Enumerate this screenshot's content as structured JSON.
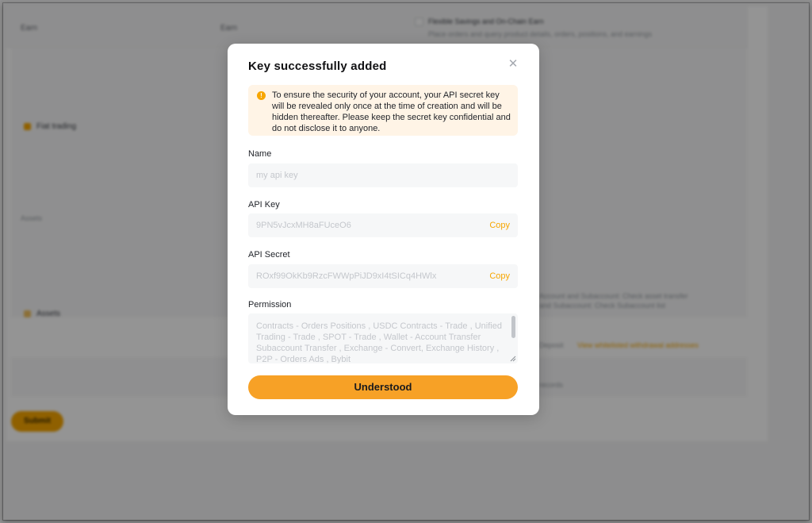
{
  "modal": {
    "title": "Key successfully added",
    "close_icon": "close-icon",
    "notice": {
      "icon": "exclamation-icon",
      "text": "To ensure the security of your account, your API secret key will be revealed only once at the time of creation and will be hidden thereafter. Please keep the secret key confidential and do not disclose it to anyone."
    },
    "name": {
      "label": "Name",
      "placeholder": "my api key"
    },
    "api_key": {
      "label": "API Key",
      "value": "9PN5vJcxMH8aFUceO6",
      "copy_label": "Copy"
    },
    "api_secret": {
      "label": "API Secret",
      "value": "ROxf99OkKb9RzcFWWpPiJD9xI4tSICq4HWlx",
      "copy_label": "Copy"
    },
    "permission": {
      "label": "Permission",
      "value": "Contracts - Orders Positions  , USDC Contracts - Trade  , Unified Trading - Trade  , SPOT - Trade  , Wallet - Account Transfer Subaccount Transfer  , Exchange - Convert,  Exchange History  , P2P - Orders Ads  , Bybit"
    },
    "confirm_label": "Understood"
  },
  "background": {
    "col1": "Earn",
    "col2": "Earn",
    "flexible_title": "Flexible Savings and On-Chain Earn",
    "flexible_desc": "Place orders and query product details, orders, positions, and earnings",
    "fiat_trading": "Fiat trading",
    "assets_label": "Assets",
    "assets_group": "Assets",
    "assets_transfer": "Account and Subaccount: Check asset transfer",
    "assets_transfer2": "and Subaccount: Check Subaccount list",
    "deposit": "Deposit",
    "withdraw_link": "View whitelisted withdrawal addresses",
    "records": "records",
    "submit": "Submit"
  },
  "colors": {
    "accent": "#f7a600",
    "notice_bg": "#fff4e6"
  }
}
